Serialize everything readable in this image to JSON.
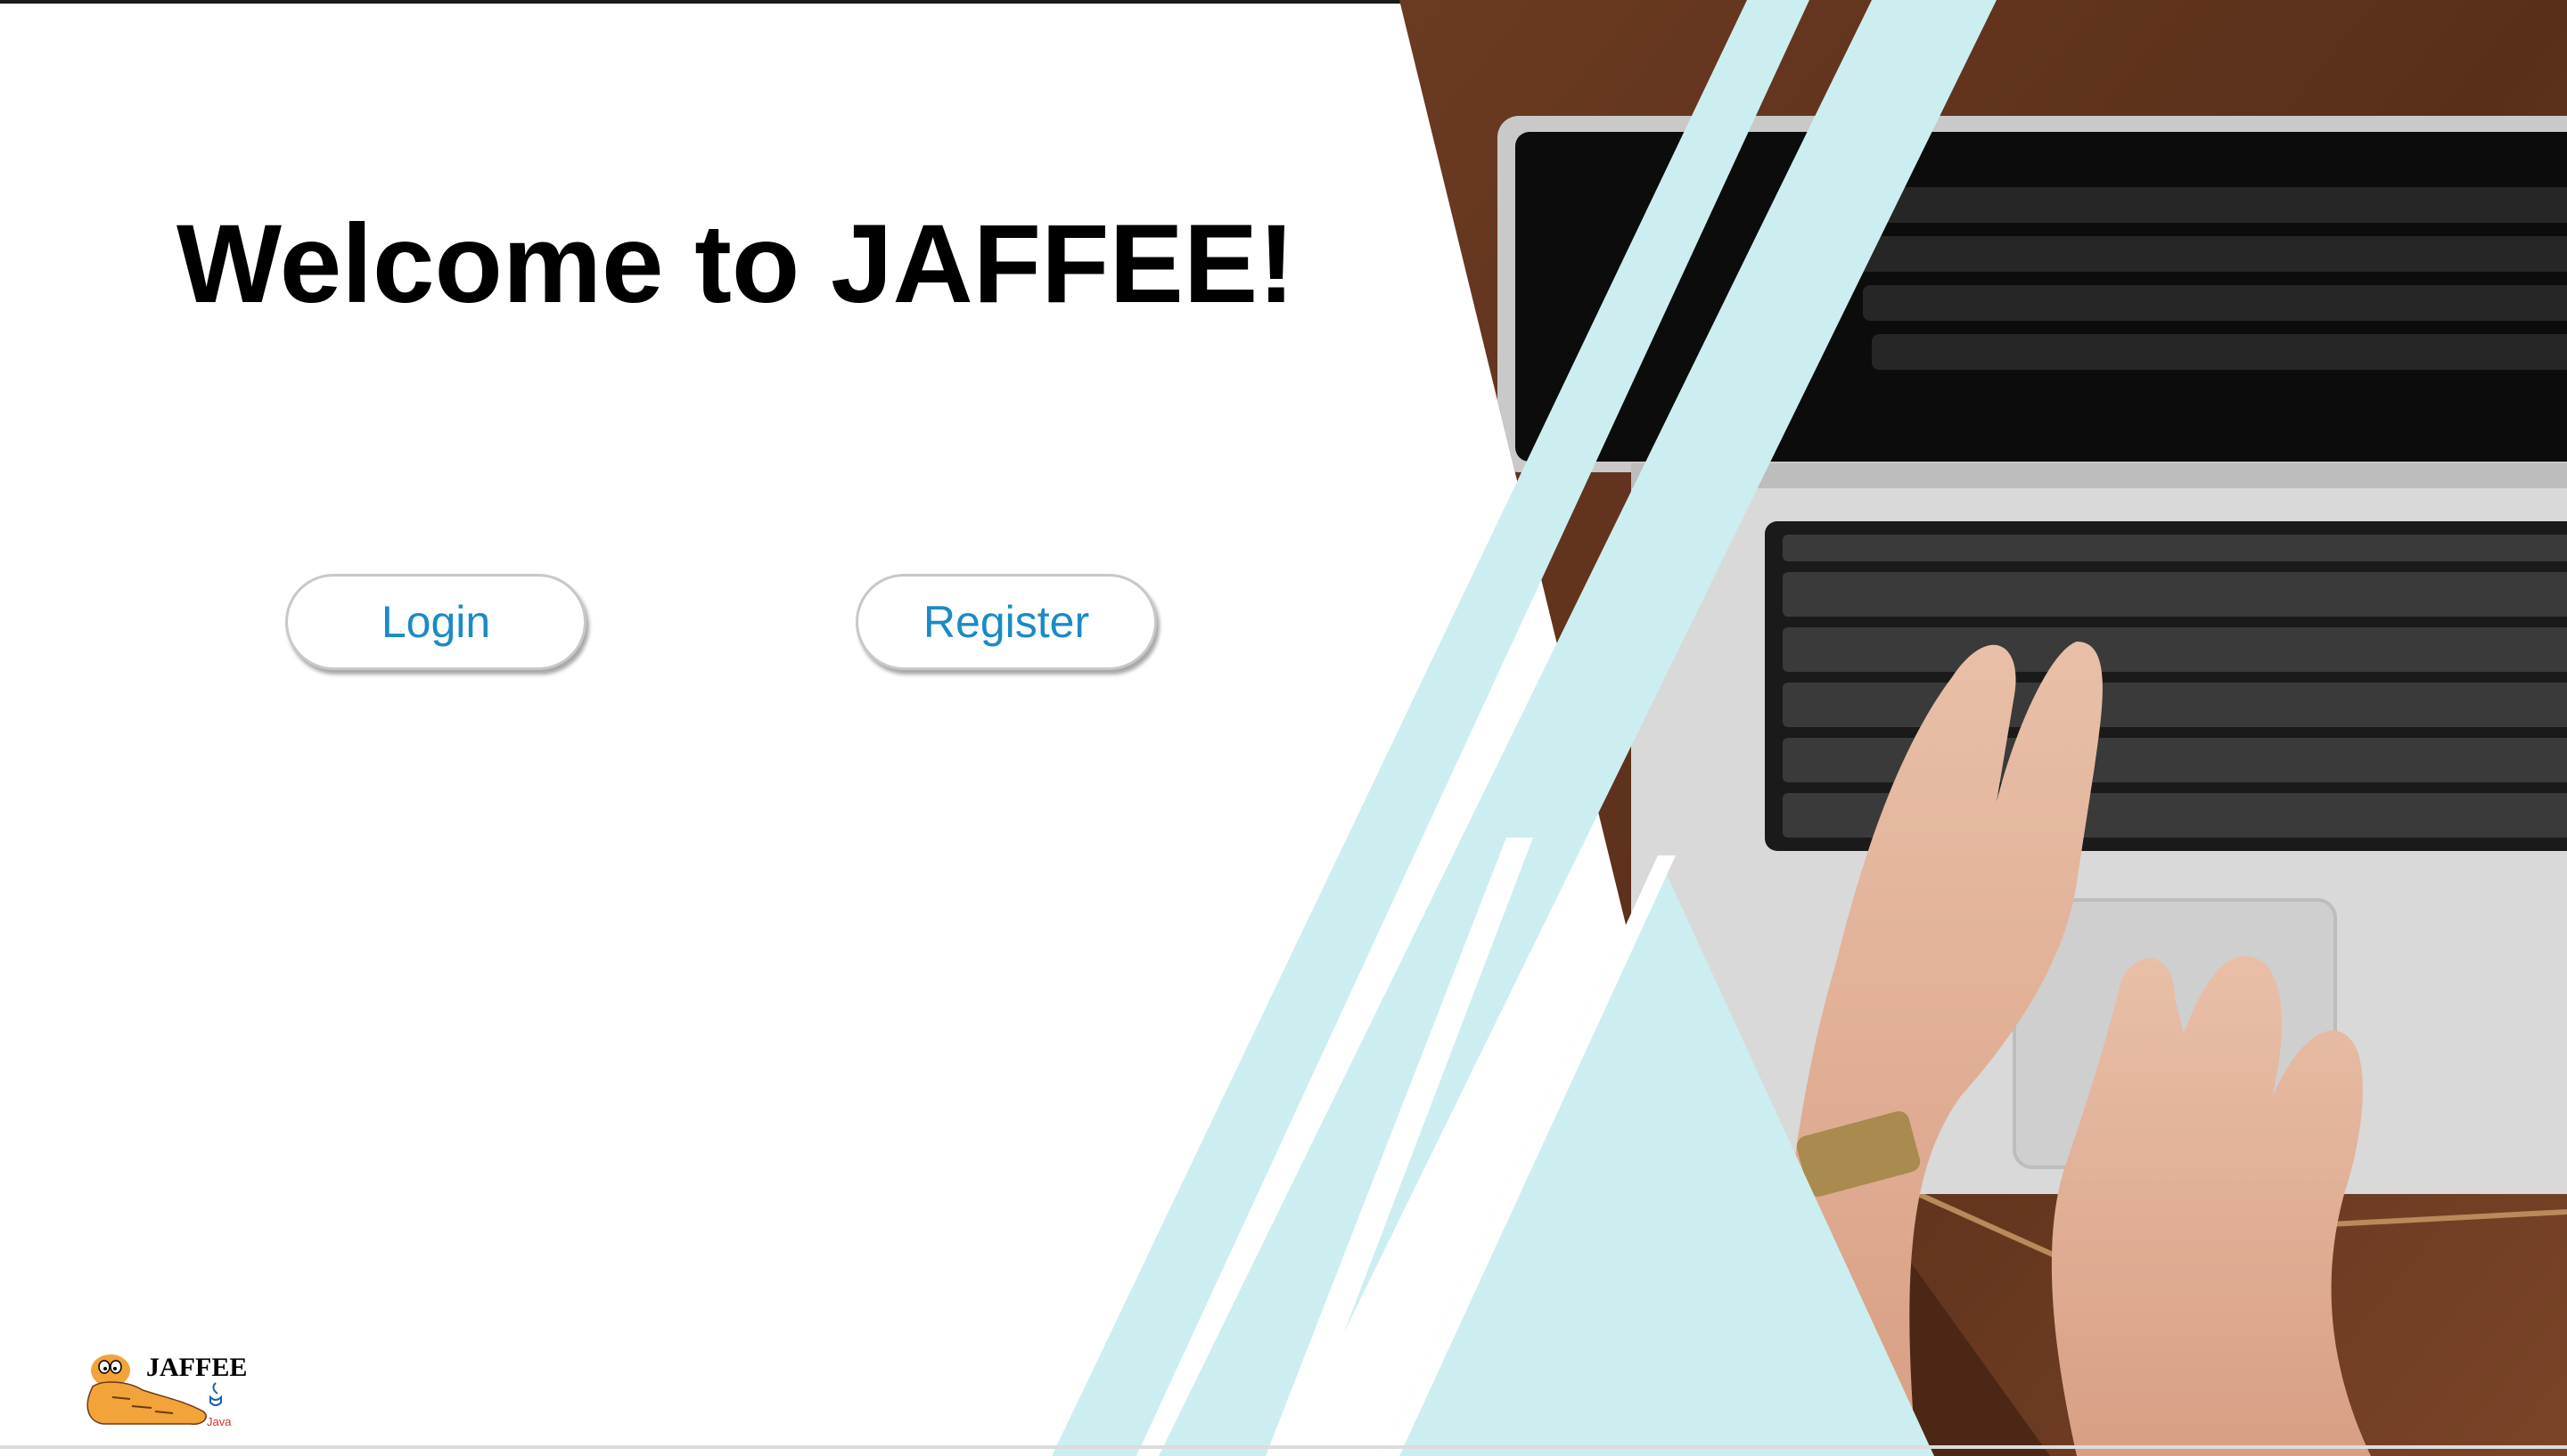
{
  "page": {
    "title": "Welcome to JAFFEE!"
  },
  "actions": {
    "login_label": "Login",
    "register_label": "Register"
  },
  "logo": {
    "name": "JAFFEE",
    "sub": "Java"
  },
  "colors": {
    "accent_text": "#1b8ac7",
    "stripe": "#cdeef1",
    "background": "#ffffff"
  },
  "icons": [
    "laptop-photo",
    "garfield-logo",
    "java-cup-icon"
  ]
}
